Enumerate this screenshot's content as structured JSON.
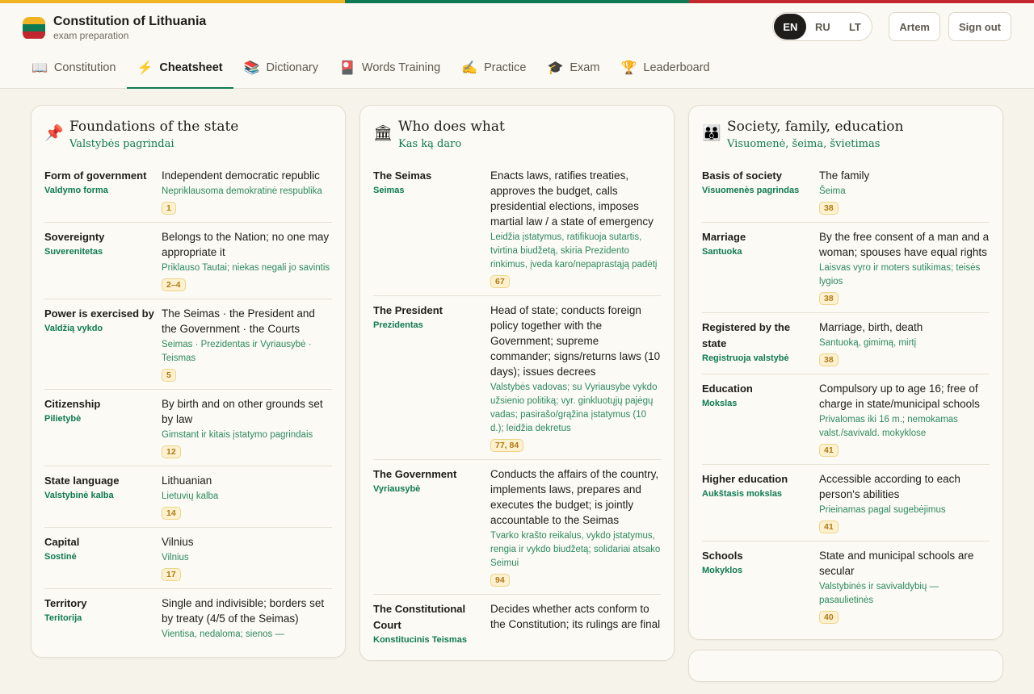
{
  "colors": {
    "flag_yellow": "#f0b323",
    "flag_green": "#0e7a53",
    "flag_red": "#c1272d",
    "accent": "#0e7a53"
  },
  "app": {
    "title": "Constitution of Lithuania",
    "subtitle": "exam preparation"
  },
  "languages": [
    {
      "code": "EN",
      "active": true
    },
    {
      "code": "RU",
      "active": false
    },
    {
      "code": "LT",
      "active": false
    }
  ],
  "user": {
    "name": "Artem",
    "signout_label": "Sign out"
  },
  "tabs": [
    {
      "icon": "open-book-icon",
      "glyph": "📖",
      "label": "Constitution",
      "active": false
    },
    {
      "icon": "lightning-icon",
      "glyph": "⚡",
      "label": "Cheatsheet",
      "active": true
    },
    {
      "icon": "books-icon",
      "glyph": "📚",
      "label": "Dictionary",
      "active": false
    },
    {
      "icon": "flashcard-icon",
      "glyph": "🎴",
      "label": "Words Training",
      "active": false
    },
    {
      "icon": "writing-hand-icon",
      "glyph": "✍",
      "label": "Practice",
      "active": false
    },
    {
      "icon": "graduation-cap-icon",
      "glyph": "🎓",
      "label": "Exam",
      "active": false
    },
    {
      "icon": "trophy-icon",
      "glyph": "🏆",
      "label": "Leaderboard",
      "active": false
    }
  ],
  "cards": [
    {
      "icon": "pushpin-icon",
      "glyph": "📌",
      "title": "Foundations of the state",
      "subtitle": "Valstybės pagrindai",
      "rows": [
        {
          "term": "Form of government",
          "term_lt": "Valdymo forma",
          "def": "Independent democratic republic",
          "def_lt": "Nepriklausoma demokratinė respublika",
          "articles": "1"
        },
        {
          "term": "Sovereignty",
          "term_lt": "Suverenitetas",
          "def": "Belongs to the Nation; no one may appropriate it",
          "def_lt": "Priklauso Tautai; niekas negali jo savintis",
          "articles": "2–4"
        },
        {
          "term": "Power is exercised by",
          "term_lt": "Valdžią vykdo",
          "def": "The Seimas · the President and the Government · the Courts",
          "def_lt": "Seimas · Prezidentas ir Vyriausybė · Teismas",
          "articles": "5"
        },
        {
          "term": "Citizenship",
          "term_lt": "Pilietybė",
          "def": "By birth and on other grounds set by law",
          "def_lt": "Gimstant ir kitais įstatymo pagrindais",
          "articles": "12"
        },
        {
          "term": "State language",
          "term_lt": "Valstybinė kalba",
          "def": "Lithuanian",
          "def_lt": "Lietuvių kalba",
          "articles": "14"
        },
        {
          "term": "Capital",
          "term_lt": "Sostinė",
          "def": "Vilnius",
          "def_lt": "Vilnius",
          "articles": "17"
        },
        {
          "term": "Territory",
          "term_lt": "Teritorija",
          "def": "Single and indivisible; borders set by treaty (4/5 of the Seimas)",
          "def_lt": "Vientisa, nedaloma; sienos —",
          "articles": ""
        }
      ]
    },
    {
      "icon": "classical-building-icon",
      "glyph": "🏛",
      "title": "Who does what",
      "subtitle": "Kas ką daro",
      "rows": [
        {
          "term": "The Seimas",
          "term_lt": "Seimas",
          "def": "Enacts laws, ratifies treaties, approves the budget, calls presidential elections, imposes martial law / a state of emergency",
          "def_lt": "Leidžia įstatymus, ratifikuoja sutartis, tvirtina biudžetą, skiria Prezidento rinkimus, įveda karo/nepaprastąją padėtį",
          "articles": "67"
        },
        {
          "term": "The President",
          "term_lt": "Prezidentas",
          "def": "Head of state; conducts foreign policy together with the Government; supreme commander; signs/returns laws (10 days); issues decrees",
          "def_lt": "Valstybės vadovas; su Vyriausybe vykdo užsienio politiką; vyr. ginkluotųjų pajėgų vadas; pasirašo/grąžina įstatymus (10 d.); leidžia dekretus",
          "articles": "77, 84"
        },
        {
          "term": "The Government",
          "term_lt": "Vyriausybė",
          "def": "Conducts the affairs of the country, implements laws, prepares and executes the budget; is jointly accountable to the Seimas",
          "def_lt": "Tvarko krašto reikalus, vykdo įstatymus, rengia ir vykdo biudžetą; solidariai atsako Seimui",
          "articles": "94"
        },
        {
          "term": "The Constitutional Court",
          "term_lt": "Konstitucinis Teismas",
          "def": "Decides whether acts conform to the Constitution; its rulings are final",
          "def_lt": "",
          "articles": ""
        }
      ]
    },
    {
      "icon": "family-icon",
      "glyph": "👪",
      "title": "Society, family, education",
      "subtitle": "Visuomenė, šeima, švietimas",
      "rows": [
        {
          "term": "Basis of society",
          "term_lt": "Visuomenės pagrindas",
          "def": "The family",
          "def_lt": "Šeima",
          "articles": "38"
        },
        {
          "term": "Marriage",
          "term_lt": "Santuoka",
          "def": "By the free consent of a man and a woman; spouses have equal rights",
          "def_lt": "Laisvas vyro ir moters sutikimas; teisės lygios",
          "articles": "38"
        },
        {
          "term": "Registered by the state",
          "term_lt": "Registruoja valstybė",
          "def": "Marriage, birth, death",
          "def_lt": "Santuoką, gimimą, mirtį",
          "articles": "38"
        },
        {
          "term": "Education",
          "term_lt": "Mokslas",
          "def": "Compulsory up to age 16; free of charge in state/municipal schools",
          "def_lt": "Privalomas iki 16 m.; nemokamas valst./savivald. mokyklose",
          "articles": "41"
        },
        {
          "term": "Higher education",
          "term_lt": "Aukštasis mokslas",
          "def": "Accessible according to each person's abilities",
          "def_lt": "Prieinamas pagal sugebėjimus",
          "articles": "41"
        },
        {
          "term": "Schools",
          "term_lt": "Mokyklos",
          "def": "State and municipal schools are secular",
          "def_lt": "Valstybinės ir savivaldybių — pasaulietinės",
          "articles": "40"
        }
      ]
    }
  ]
}
